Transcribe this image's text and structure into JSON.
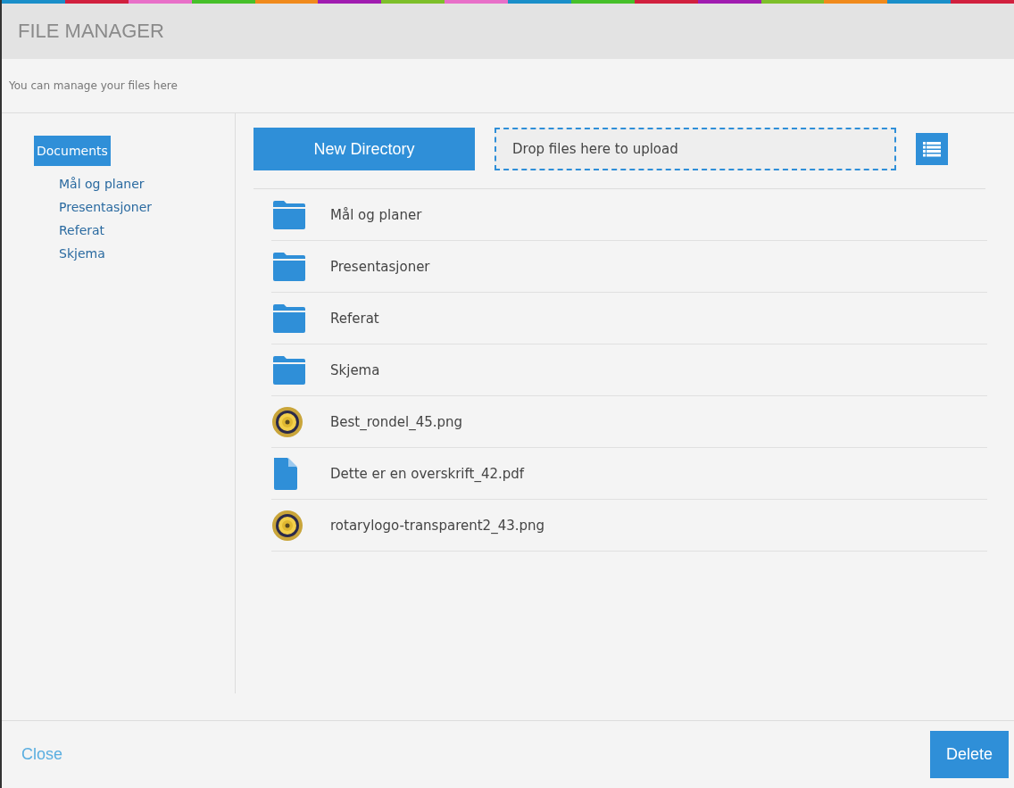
{
  "window": {
    "title": "FILE MANAGER",
    "subtitle": "You can manage your files here"
  },
  "sidebar": {
    "items": [
      {
        "label": "Documents",
        "selected": true,
        "children": [
          {
            "label": "Mål og planer",
            "selected": false
          },
          {
            "label": "Presentasjoner",
            "selected": false
          },
          {
            "label": "Referat",
            "selected": false
          },
          {
            "label": "Skjema",
            "selected": false
          }
        ]
      }
    ]
  },
  "toolbar": {
    "new_directory": "New Directory",
    "dropzone": "Drop files here to upload"
  },
  "files": [
    {
      "kind": "folder",
      "name": "Mål og planer"
    },
    {
      "kind": "folder",
      "name": "Presentasjoner"
    },
    {
      "kind": "folder",
      "name": "Referat"
    },
    {
      "kind": "folder",
      "name": "Skjema"
    },
    {
      "name": "Best_rondel_45.png"
    },
    {
      "kind": "document",
      "name": "Dette er en overskrift_42.pdf"
    },
    {
      "name": "rotarylogo-transparent2_43.png"
    }
  ],
  "footer": {
    "close": "Close",
    "delete": "Delete"
  }
}
